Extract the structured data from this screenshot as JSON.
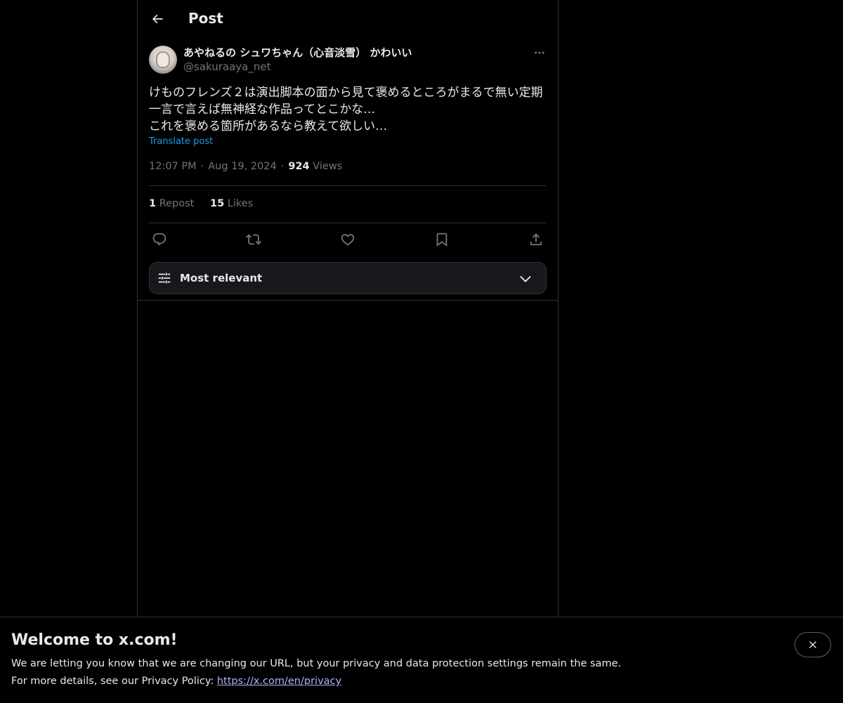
{
  "header": {
    "title": "Post",
    "back_icon": "arrow-left-icon"
  },
  "post": {
    "author_name": "あやねるの シュワちゃん（心音淡雪） かわいい",
    "author_handle": "@sakuraaya_net",
    "text_lines": [
      "けものフレンズ２は演出脚本の面から見て褒めるところがまるで無い定期",
      "一言で言えば無神経な作品ってとこかな…",
      "これを褒める箇所があるなら教えて欲しい…"
    ],
    "translate_label": "Translate post",
    "time": "12:07 PM",
    "date": "Aug 19, 2024",
    "views_count": "924",
    "views_label": "Views",
    "reposts_count": "1",
    "reposts_label": "Repost",
    "likes_count": "15",
    "likes_label": "Likes"
  },
  "actions": {
    "reply_icon": "reply-icon",
    "repost_icon": "repost-icon",
    "like_icon": "heart-icon",
    "bookmark_icon": "bookmark-icon",
    "share_icon": "share-icon"
  },
  "sort": {
    "label": "Most relevant"
  },
  "banner": {
    "title": "Welcome to x.com!",
    "line1": "We are letting you know that we are changing our URL, but your privacy and data protection settings remain the same.",
    "line2_prefix": "For more details, see our Privacy Policy: ",
    "link_text": "https://x.com/en/privacy"
  },
  "colors": {
    "background": "#000000",
    "text": "#e7e9ea",
    "muted": "#71767b",
    "link": "#1d9bf0",
    "border": "#2f3336"
  }
}
